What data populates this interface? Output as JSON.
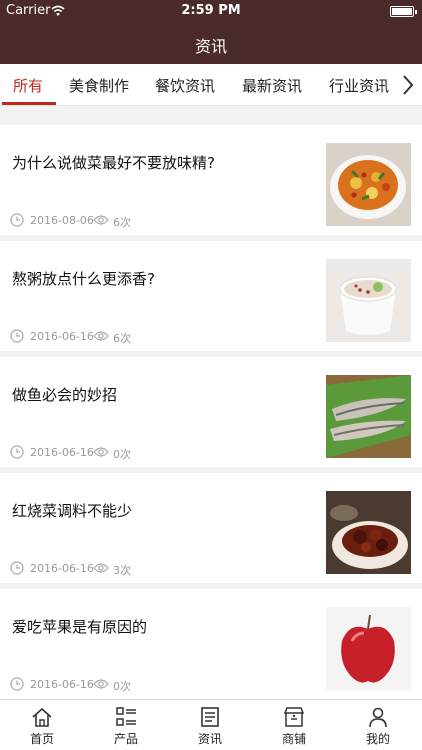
{
  "status_bar": {
    "carrier": "Carrier",
    "time": "2:59 PM"
  },
  "nav": {
    "title": "资讯"
  },
  "tabs": [
    {
      "label": "所有",
      "active": true
    },
    {
      "label": "美食制作"
    },
    {
      "label": "餐饮资讯"
    },
    {
      "label": "最新资讯"
    },
    {
      "label": "行业资讯"
    }
  ],
  "articles": [
    {
      "title": "为什么说做菜最好不要放味精?",
      "date": "2016-08-06",
      "views": "6次",
      "image": "stir-fry-dish"
    },
    {
      "title": "熬粥放点什么更添香?",
      "date": "2016-06-16",
      "views": "6次",
      "image": "congee-bowl"
    },
    {
      "title": "做鱼必会的妙招",
      "date": "2016-06-16",
      "views": "0次",
      "image": "fish-on-leaf"
    },
    {
      "title": "红烧菜调料不能少",
      "date": "2016-06-16",
      "views": "3次",
      "image": "braised-meat"
    },
    {
      "title": "爱吃苹果是有原因的",
      "date": "2016-06-16",
      "views": "0次",
      "image": "red-apple"
    }
  ],
  "tabbar": [
    {
      "label": "首页",
      "icon": "home-icon"
    },
    {
      "label": "产品",
      "icon": "grid-list-icon"
    },
    {
      "label": "资讯",
      "icon": "document-icon"
    },
    {
      "label": "商铺",
      "icon": "shop-icon"
    },
    {
      "label": "我的",
      "icon": "person-icon"
    }
  ],
  "colors": {
    "header": "#4a2a2a",
    "accent": "#c0281e",
    "meta": "#999999"
  }
}
